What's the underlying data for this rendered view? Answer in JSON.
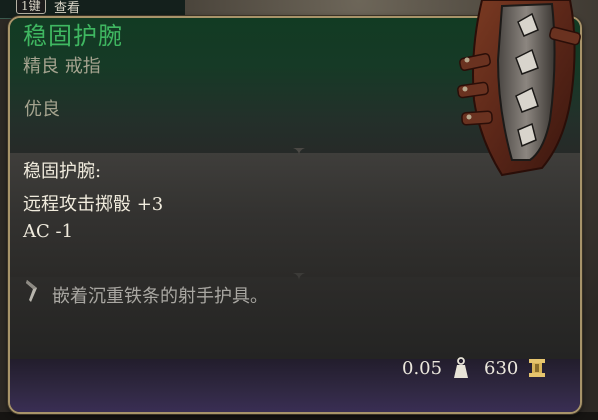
{
  "hotbar": {
    "key": "1键",
    "hint": "查看"
  },
  "item": {
    "name": "稳固护腕",
    "type": "精良 戒指",
    "rarity": "优良",
    "stats_title": "稳固护腕:",
    "stats": [
      "远程攻击掷骰 +3",
      "AC -1"
    ],
    "description": "嵌着沉重铁条的射手护具。",
    "weight": "0.05",
    "price": "630",
    "icons": {
      "description": "quill-icon",
      "weight": "weight-icon",
      "price": "gold-coin-icon",
      "art": "bracer-item-icon"
    }
  },
  "colors": {
    "name": "#3fb761",
    "border": "#a8946a",
    "footer": "#3b2f57"
  }
}
